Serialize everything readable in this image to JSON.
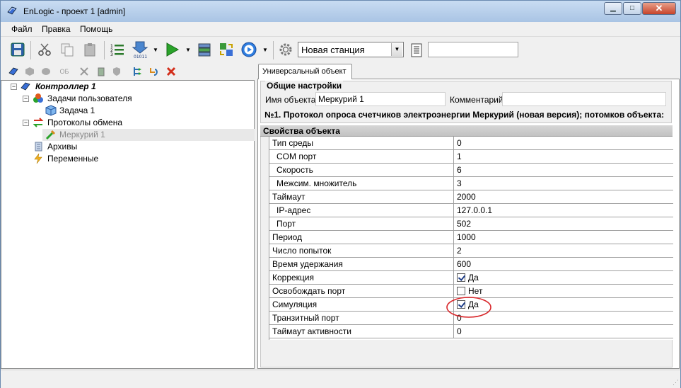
{
  "window": {
    "title": "EnLogic - проект 1 [admin]"
  },
  "menu": [
    "Файл",
    "Правка",
    "Помощь"
  ],
  "toolbar": {
    "station_select": "Новая станция",
    "extra_input": ""
  },
  "left_toolbar": {
    "ob_label": "ОБ"
  },
  "tree": {
    "controller": "Контроллер 1",
    "user_tasks": "Задачи пользователя",
    "task1": "Задача 1",
    "protocols": "Протоколы обмена",
    "mercury": "Меркурий 1",
    "archives": "Архивы",
    "variables": "Переменные"
  },
  "tab": {
    "label": "Универсальный объект"
  },
  "general": {
    "header": "Общие настройки",
    "name_label": "Имя объекта",
    "name_value": "Меркурий 1",
    "comment_label": "Комментарий",
    "comment_value": "",
    "description": "№1. Протокол опроса счетчиков электроэнергии Меркурий (новая версия); потомков объекта:"
  },
  "properties": {
    "header": "Свойства объекта",
    "rows": [
      {
        "key": "Тип среды",
        "value": "0",
        "indent": false
      },
      {
        "key": "COM порт",
        "value": "1",
        "indent": true
      },
      {
        "key": "Скорость",
        "value": "6",
        "indent": true
      },
      {
        "key": "Межсим. множитель",
        "value": "3",
        "indent": true
      },
      {
        "key": "Таймаут",
        "value": "2000",
        "indent": false
      },
      {
        "key": "IP-адрес",
        "value": "127.0.0.1",
        "indent": true
      },
      {
        "key": "Порт",
        "value": "502",
        "indent": true
      },
      {
        "key": "Период",
        "value": "1000",
        "indent": false
      },
      {
        "key": "Число попыток",
        "value": "2",
        "indent": false
      },
      {
        "key": "Время удержания",
        "value": "600",
        "indent": false
      },
      {
        "key": "Коррекция",
        "value": "Да",
        "checkbox": true,
        "checked": true,
        "indent": false
      },
      {
        "key": "Освобождать порт",
        "value": "Нет",
        "checkbox": true,
        "checked": false,
        "indent": false
      },
      {
        "key": "Симуляция",
        "value": "Да",
        "checkbox": true,
        "checked": true,
        "indent": false,
        "highlighted": true
      },
      {
        "key": "Транзитный порт",
        "value": "0",
        "indent": false
      },
      {
        "key": "Таймаут активности",
        "value": "0",
        "indent": false
      }
    ]
  },
  "colors": {
    "highlight_circle": "#d8262a",
    "title_bar": "#b9d1ea"
  }
}
